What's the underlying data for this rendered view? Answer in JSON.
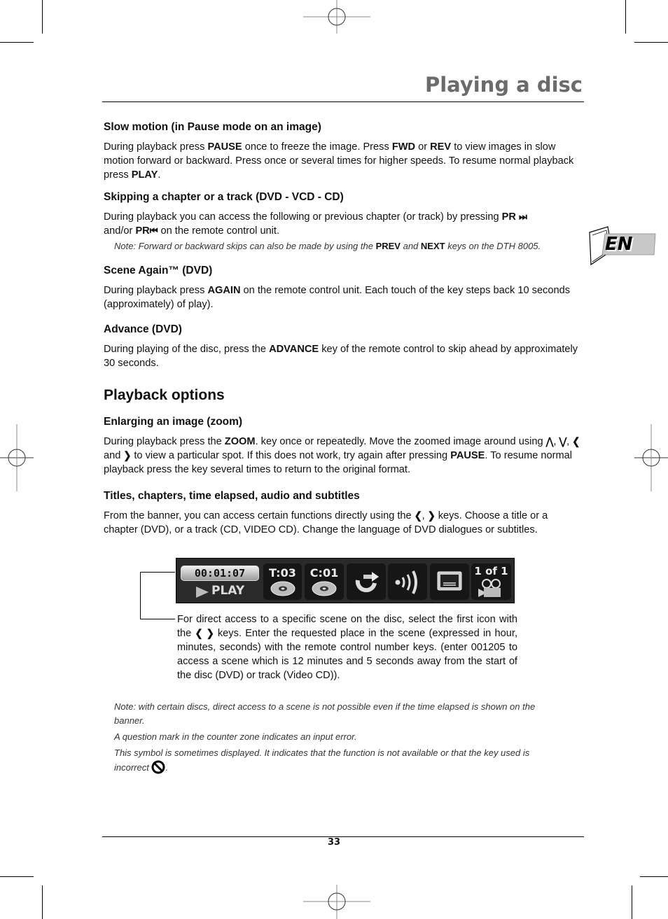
{
  "header": {
    "title": "Playing a disc"
  },
  "language_tab": {
    "label": "EN"
  },
  "sections": {
    "slow_motion": {
      "heading": "Slow motion (in Pause mode on an image)",
      "t1": "During playback press ",
      "b1": "PAUSE",
      "t2": " once to freeze the image. Press ",
      "b2": "FWD",
      "t3": " or ",
      "b3": "REV",
      "t4": " to view images in slow motion forward or backward. Press once or several times for higher speeds. To resume normal playback press ",
      "b4": "PLAY",
      "t5": "."
    },
    "skipping": {
      "heading": "Skipping a chapter or a track (DVD - VCD - CD)",
      "t1": "During playback you can access the following or previous chapter (or track) by pressing ",
      "b1": "PR",
      "next_glyph": "⏭",
      "t2": " and/or ",
      "b2": "PR",
      "prev_glyph": "⏮",
      "t3": "  on the remote control unit.",
      "note_t1": "Note: Forward or backward skips can also be made by using the ",
      "note_b1": "PREV",
      "note_t2": " and ",
      "note_b2": "NEXT",
      "note_t3": " keys on the DTH 8005."
    },
    "scene_again": {
      "heading": "Scene Again™ (DVD)",
      "t1": "During playback press ",
      "b1": "AGAIN",
      "t2": " on the remote control unit. Each touch of the key steps back 10 seconds (approximately) of play)."
    },
    "advance": {
      "heading": "Advance (DVD)",
      "t1": "During playing of the disc, press the ",
      "b1": "ADVANCE",
      "t2": " key of the remote control to skip ahead by approximately 30 seconds."
    },
    "playback_options": {
      "heading": "Playback options"
    },
    "zoom": {
      "heading": "Enlarging an image (zoom)",
      "t1": "During playback press the ",
      "b1": "ZOOM",
      "t2": ". key once or repeatedly. Move the zoomed image around using ",
      "up": "⋀",
      "down": "⋁",
      "left": "❮",
      "right": "❯",
      "sep1": ", ",
      "sep2": ", ",
      "and": " and ",
      "t3": " to view a particular spot. If this does not work, try again after pressing ",
      "b2": "PAUSE",
      "t4": ". To resume normal playback press the key several times to return to the original format."
    },
    "titles": {
      "heading": "Titles, chapters, time elapsed, audio and subtitles",
      "t1": "From the banner, you can access certain functions directly using the ",
      "left": "❮",
      "sep": ", ",
      "right": "❯",
      "t2": " keys. Choose a title or a chapter (DVD), or a track (CD, VIDEO CD). Change the language of DVD dialogues or subtitles."
    }
  },
  "banner": {
    "time": "00:01:07",
    "play": "PLAY",
    "title": "T:03",
    "chapter": "C:01",
    "angle": "1 of 1",
    "icons": [
      "repeat-icon",
      "audio-icon",
      "subtitle-icon",
      "camera-angle-icon"
    ]
  },
  "callout": {
    "t1": "For direct access to a specific scene on the disc, select the first icon with the ",
    "left": "❮",
    "right": "❯",
    "t2": " keys. Enter the requested place in the scene (expressed in hour, minutes, seconds) with the remote control number keys. (enter 001205 to access a scene which is 12 minutes and 5 seconds away from the start of the disc (DVD) or track (Video CD))."
  },
  "notes": [
    "Note: with certain discs, direct access to a scene is not possible even if the time elapsed is shown on the banner.",
    "A question mark in the counter zone indicates an input error.",
    "This symbol is sometimes displayed. It indicates that the function is not available or that the key used is incorrect "
  ],
  "notes_end": ".",
  "footer": {
    "page_number": "33"
  }
}
